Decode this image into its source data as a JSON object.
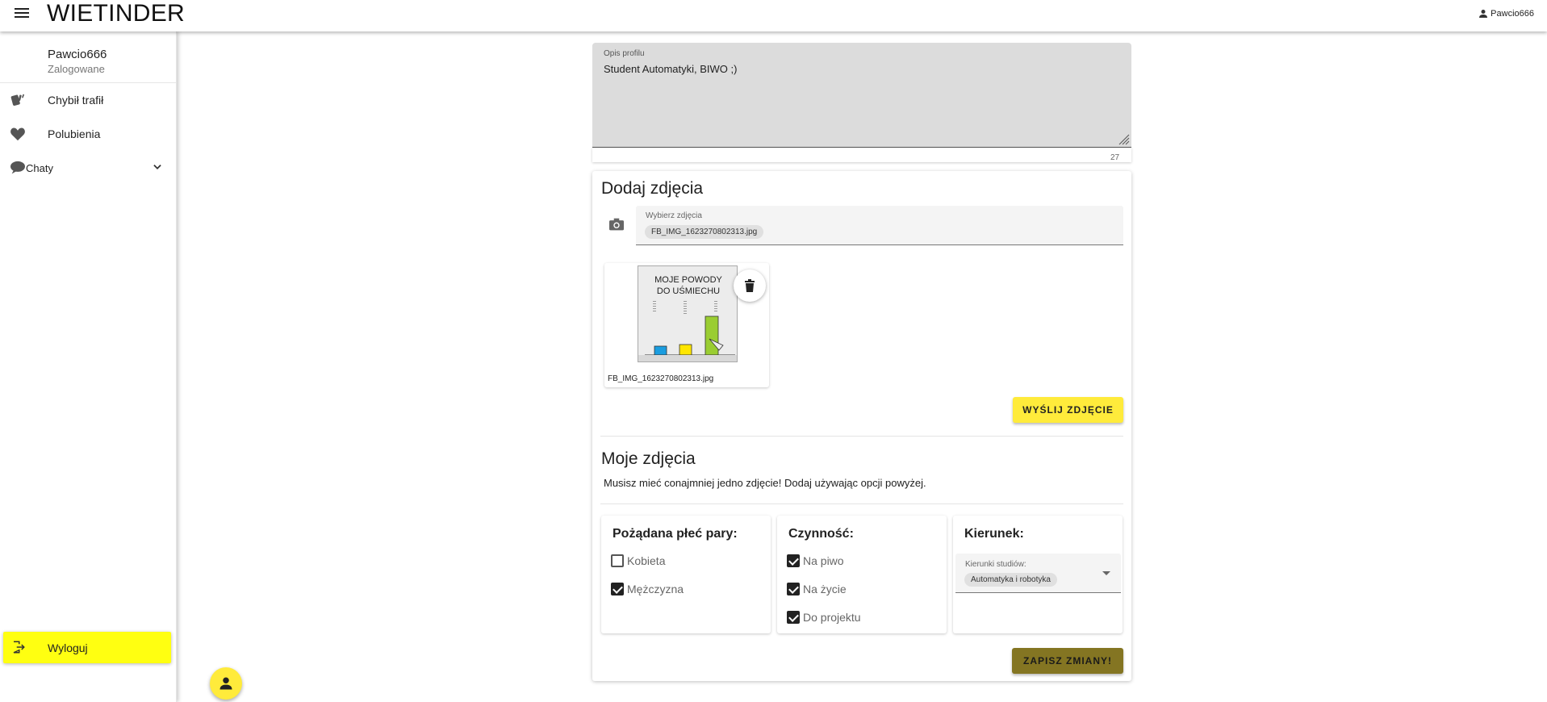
{
  "app": {
    "title": "WIETINDER",
    "account_name": "Pawcio666"
  },
  "sidebar": {
    "user_name": "Pawcio666",
    "user_status": "Zalogowane",
    "items": [
      {
        "label": "Chybił trafił",
        "icon": "cards-icon"
      },
      {
        "label": "Polubienia",
        "icon": "heart-icon"
      },
      {
        "label": "Chaty",
        "icon": "chat-icon"
      }
    ],
    "logout_label": "Wyloguj"
  },
  "profile": {
    "description_label": "Opis profilu",
    "description_value": "Student Automatyki, BIWO ;)",
    "char_count": "27"
  },
  "photos": {
    "add_title": "Dodaj zdjęcia",
    "picker_label": "Wybierz zdjęcia",
    "picker_file": "FB_IMG_1623270802313.jpg",
    "preview_name": "FB_IMG_1623270802313.jpg",
    "preview_image_text": {
      "title_line1": "MOJE POWODY",
      "title_line2": "DO UŚMIECHU"
    },
    "send_button": "WYŚLIJ ZDJĘCIE",
    "my_title": "Moje zdjęcia",
    "my_hint": "Musisz mieć conajmniej jedno zdjęcie! Dodaj używając opcji powyżej."
  },
  "filters": {
    "gender": {
      "title": "Pożądana płeć pary:",
      "options": [
        {
          "label": "Kobieta",
          "checked": false
        },
        {
          "label": "Mężczyzna",
          "checked": true
        }
      ]
    },
    "activity": {
      "title": "Czynność:",
      "options": [
        {
          "label": "Na piwo",
          "checked": true
        },
        {
          "label": "Na życie",
          "checked": true
        },
        {
          "label": "Do projektu",
          "checked": true
        }
      ]
    },
    "direction": {
      "title": "Kierunek:",
      "select_label": "Kierunki studiów:",
      "selected": "Automatyka i robotyka"
    }
  },
  "save_button": "ZAPISZ ZMIANY!",
  "colors": {
    "accent_yellow": "#ffeb3b",
    "logout_yellow": "#ffff11",
    "save_olive": "#847522"
  }
}
